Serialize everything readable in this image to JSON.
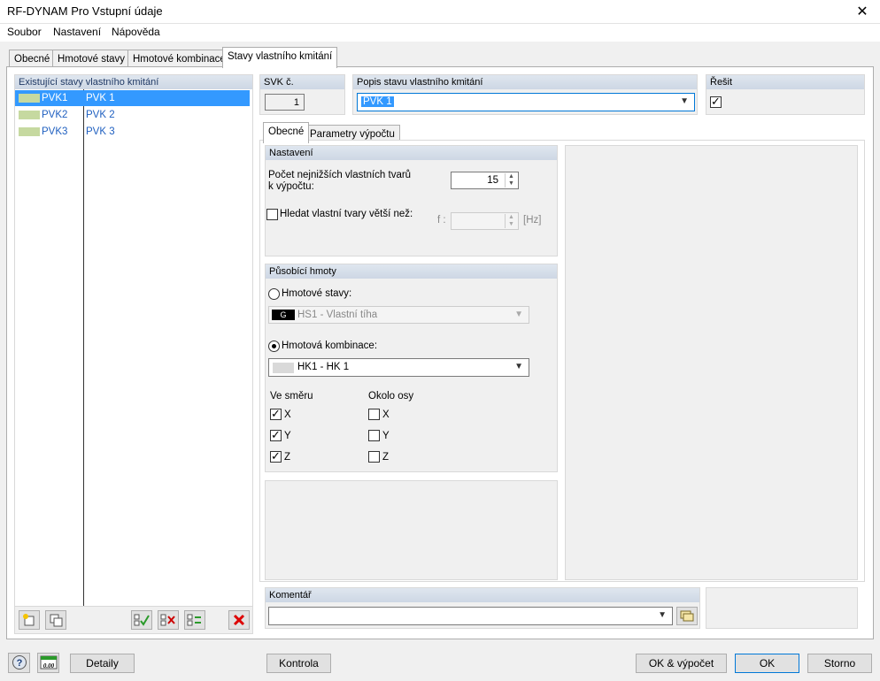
{
  "window": {
    "title": "RF-DYNAM Pro Vstupní údaje",
    "close": "✕"
  },
  "menu": {
    "items": [
      "Soubor",
      "Nastavení",
      "Nápověda"
    ]
  },
  "tabs": [
    "Obecné",
    "Hmotové stavy",
    "Hmotové kombinace",
    "Stavy vlastního kmitání"
  ],
  "left_panel": {
    "header": "Existující stavy vlastního kmitání",
    "rows": [
      {
        "id": "PVK1",
        "name": "PVK 1"
      },
      {
        "id": "PVK2",
        "name": "PVK 2"
      },
      {
        "id": "PVK3",
        "name": "PVK 3"
      }
    ]
  },
  "svk": {
    "label": "SVK č.",
    "value": "1"
  },
  "popis": {
    "label": "Popis stavu vlastního kmitání",
    "value": "PVK 1"
  },
  "resit": {
    "label": "Řešit",
    "checked": true
  },
  "subtabs": [
    "Obecné",
    "Parametry výpočtu"
  ],
  "nastaveni": {
    "header": "Nastavení",
    "count_label_line1": "Počet nejnižších vlastních tvarů",
    "count_label_line2": "k výpočtu:",
    "count_value": "15",
    "search_label": "Hledat vlastní tvary větší než:",
    "f_label": "f :",
    "hz_label": "[Hz]"
  },
  "hmoty": {
    "header": "Působící hmoty",
    "radio_stavy": "Hmotové stavy:",
    "stavy_value": "HS1 - Vlastní tíha",
    "stavy_badge": "G",
    "radio_kombinace": "Hmotová kombinace:",
    "kombinace_value": "HK1 - HK 1",
    "ve_smeru": "Ve směru",
    "okolo_osy": "Okolo osy",
    "axes": [
      "X",
      "Y",
      "Z"
    ]
  },
  "komentar": {
    "label": "Komentář"
  },
  "footer": {
    "detaily": "Detaily",
    "kontrola": "Kontrola",
    "ok_vypocet": "OK & výpočet",
    "ok": "OK",
    "storno": "Storno",
    "units_icon": "0.00"
  },
  "colors": {
    "selection": "#3399ff",
    "link": "#2060c0",
    "swatch": "#c6d9a0"
  }
}
